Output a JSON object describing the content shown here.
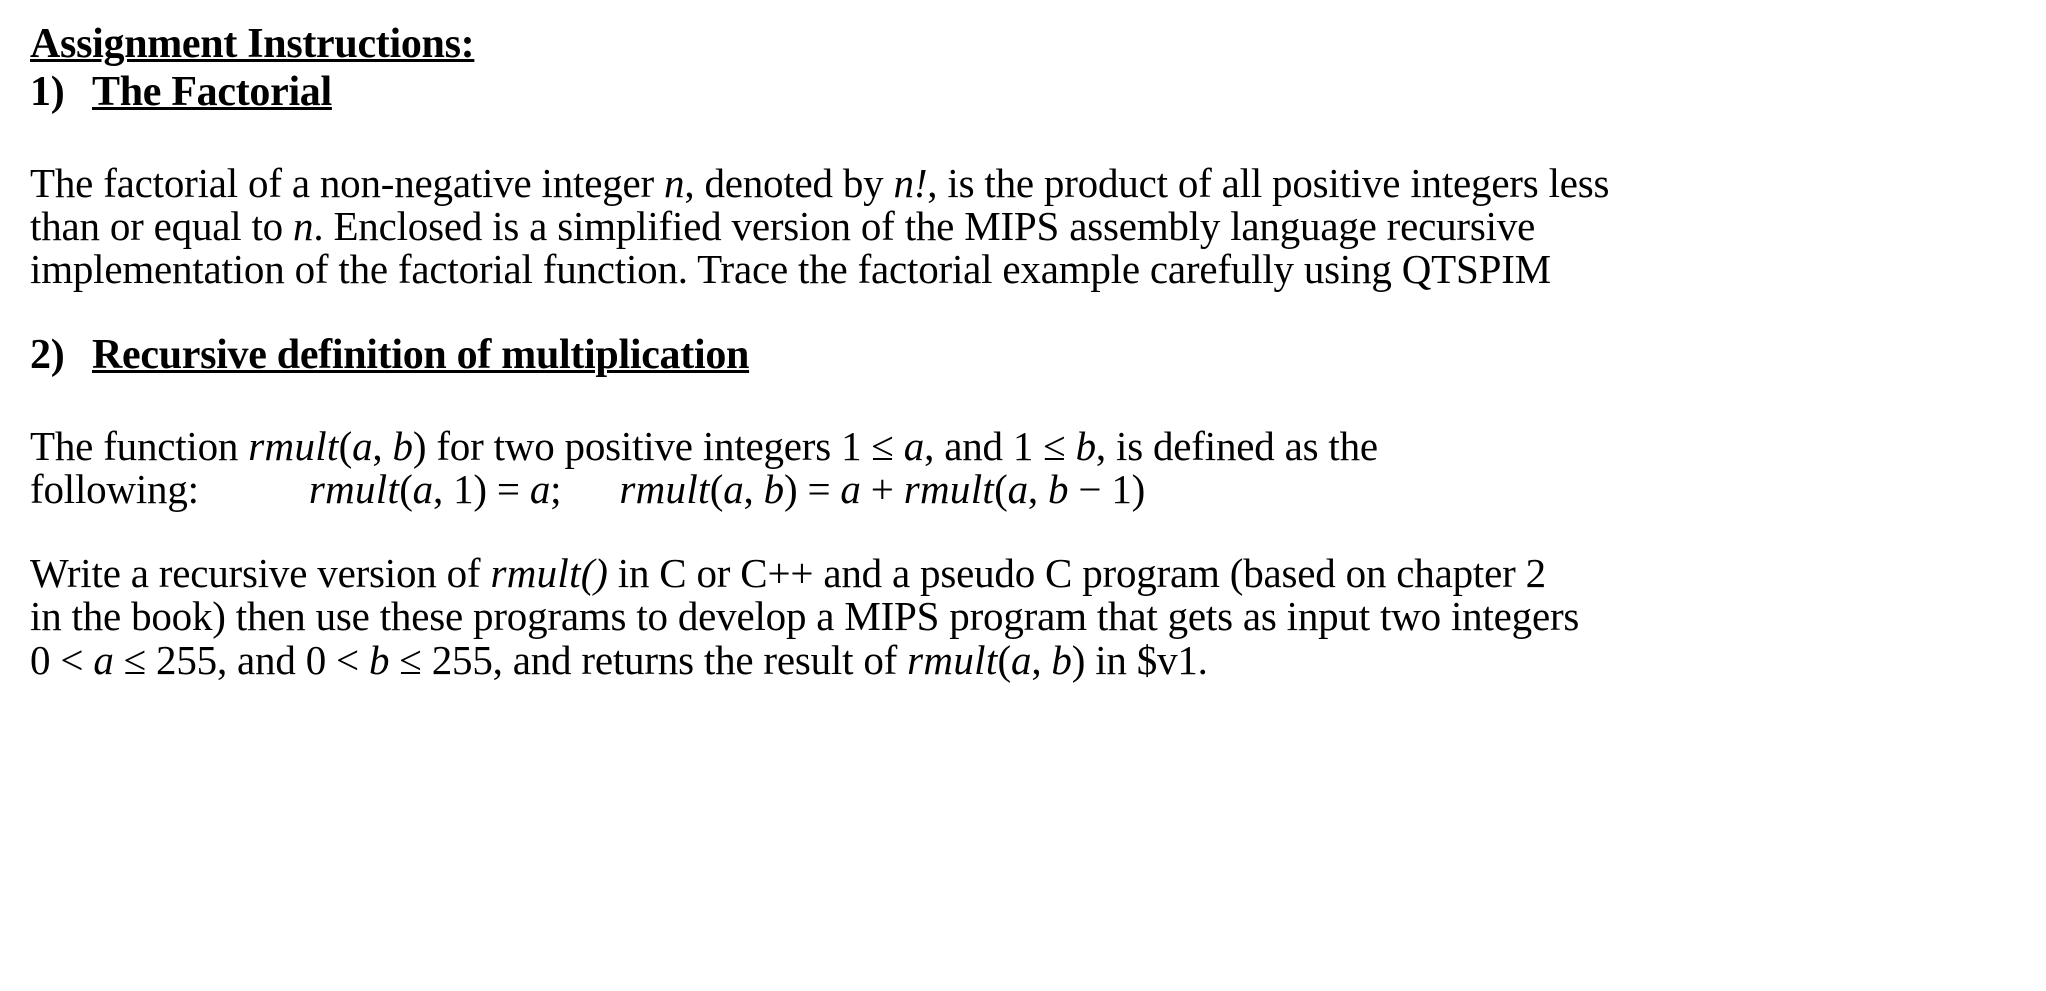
{
  "document": {
    "title": "Assignment Instructions:",
    "sections": [
      {
        "number": "1)",
        "heading": "The Factorial",
        "body_lines": [
          {
            "parts": [
              {
                "t": "The factorial of a non-negative integer ",
                "s": "normal"
              },
              {
                "t": "n",
                "s": "italic"
              },
              {
                "t": ", denoted by ",
                "s": "normal"
              },
              {
                "t": "n!",
                "s": "italic"
              },
              {
                "t": ",  is the product of all positive integers less",
                "s": "normal"
              }
            ]
          },
          {
            "parts": [
              {
                "t": "than or equal to ",
                "s": "normal"
              },
              {
                "t": "n",
                "s": "italic"
              },
              {
                "t": ". Enclosed is a simplified version of the MIPS assembly language recursive",
                "s": "normal"
              }
            ]
          },
          {
            "parts": [
              {
                "t": "implementation of the factorial function. Trace the factorial example carefully using QTSPIM",
                "s": "normal"
              }
            ]
          }
        ]
      },
      {
        "number": "2)",
        "heading": "Recursive definition of multiplication",
        "body_lines": [
          {
            "parts": [
              {
                "t": "The function ",
                "s": "normal"
              },
              {
                "t": "rmult",
                "s": "func"
              },
              {
                "t": "(",
                "s": "normal"
              },
              {
                "t": "a",
                "s": "italic"
              },
              {
                "t": ", ",
                "s": "normal"
              },
              {
                "t": "b",
                "s": "italic"
              },
              {
                "t": ") for two positive integers 1 ",
                "s": "normal"
              },
              {
                "t": "≤",
                "s": "normal"
              },
              {
                "t": " ",
                "s": "normal"
              },
              {
                "t": "a",
                "s": "italic"
              },
              {
                "t": ", and 1 ",
                "s": "normal"
              },
              {
                "t": "≤",
                "s": "normal"
              },
              {
                "t": " ",
                "s": "normal"
              },
              {
                "t": "b",
                "s": "italic"
              },
              {
                "t": ", is defined as the",
                "s": "normal"
              }
            ]
          },
          {
            "parts": [
              {
                "t": "following:",
                "s": "normal"
              },
              {
                "t": "GAP",
                "s": "gap"
              },
              {
                "t": "rmult",
                "s": "func"
              },
              {
                "t": "(",
                "s": "normal"
              },
              {
                "t": "a",
                "s": "italic"
              },
              {
                "t": ", 1) = ",
                "s": "normal"
              },
              {
                "t": "a",
                "s": "italic"
              },
              {
                "t": ";",
                "s": "normal"
              },
              {
                "t": "GAPSM",
                "s": "gap"
              },
              {
                "t": "rmult",
                "s": "func"
              },
              {
                "t": "(",
                "s": "normal"
              },
              {
                "t": "a",
                "s": "italic"
              },
              {
                "t": ", ",
                "s": "normal"
              },
              {
                "t": "b",
                "s": "italic"
              },
              {
                "t": ") = ",
                "s": "normal"
              },
              {
                "t": "a",
                "s": "italic"
              },
              {
                "t": " + ",
                "s": "normal"
              },
              {
                "t": "rmult",
                "s": "func"
              },
              {
                "t": "(",
                "s": "normal"
              },
              {
                "t": "a",
                "s": "italic"
              },
              {
                "t": ", ",
                "s": "normal"
              },
              {
                "t": "b",
                "s": "italic"
              },
              {
                "t": " − 1)",
                "s": "normal"
              }
            ]
          }
        ]
      }
    ],
    "closing_paragraph": [
      {
        "parts": [
          {
            "t": "Write a recursive version of ",
            "s": "normal"
          },
          {
            "t": "rmult",
            "s": "func"
          },
          {
            "t": "()",
            "s": "italic"
          },
          {
            "t": " in C or C++ and a pseudo C program (based on chapter 2",
            "s": "normal"
          }
        ]
      },
      {
        "parts": [
          {
            "t": "in the book) then use these programs to develop a MIPS program that gets as input  two integers",
            "s": "normal"
          }
        ]
      },
      {
        "parts": [
          {
            "t": "0 < ",
            "s": "normal"
          },
          {
            "t": "a",
            "s": "italic"
          },
          {
            "t": " ≤ 255, and 0 < ",
            "s": "normal"
          },
          {
            "t": "b",
            "s": "italic"
          },
          {
            "t": " ≤ 255, and returns the result of ",
            "s": "normal"
          },
          {
            "t": "rmult",
            "s": "func"
          },
          {
            "t": "(",
            "s": "normal"
          },
          {
            "t": "a",
            "s": "italic"
          },
          {
            "t": ", ",
            "s": "normal"
          },
          {
            "t": "b",
            "s": "italic"
          },
          {
            "t": ") in $v1.",
            "s": "normal"
          }
        ]
      }
    ]
  },
  "style": {
    "background_color": "#ffffff",
    "text_color": "#000000"
  }
}
